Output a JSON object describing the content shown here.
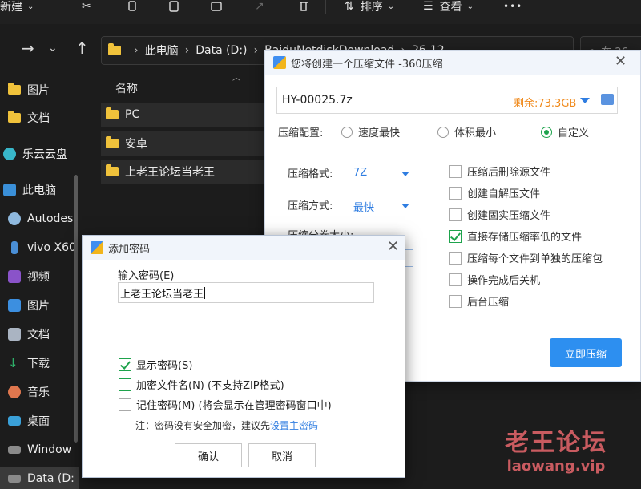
{
  "toolbar": {
    "new_label": "新建",
    "sort_label": "排序",
    "view_label": "查看",
    "more_label": "•••"
  },
  "address": {
    "parts": [
      "此电脑",
      "Data (D:)",
      "BaiduNetdiskDownload",
      "26-12"
    ],
    "search_placeholder": "在 26"
  },
  "sidebar": {
    "items": [
      {
        "label": "图片"
      },
      {
        "label": "文档"
      },
      {
        "label": "乐云云盘"
      },
      {
        "label": "此电脑"
      },
      {
        "label": "Autodes"
      },
      {
        "label": "vivo X60"
      },
      {
        "label": "视频"
      },
      {
        "label": "图片"
      },
      {
        "label": "文档"
      },
      {
        "label": "下载"
      },
      {
        "label": "音乐"
      },
      {
        "label": "桌面"
      },
      {
        "label": "Window"
      },
      {
        "label": "Data (D:"
      }
    ]
  },
  "filelist": {
    "column_name": "名称",
    "rows": [
      {
        "name": "PC"
      },
      {
        "name": "安卓"
      },
      {
        "name": "上老王论坛当老王"
      }
    ]
  },
  "compress_dialog": {
    "title": "您将创建一个压缩文件 -360压缩",
    "filename": "HY-00025.7z",
    "remaining": "剩余:73.3GB",
    "config_label": "压缩配置:",
    "radios": [
      {
        "label": "速度最快",
        "checked": false
      },
      {
        "label": "体积最小",
        "checked": false
      },
      {
        "label": "自定义",
        "checked": true
      }
    ],
    "format_label": "压缩格式:",
    "format_value": "7Z",
    "method_label": "压缩方式:",
    "method_value": "最快",
    "split_label": "压缩分卷大小:",
    "options": [
      {
        "label": "压缩后删除源文件",
        "checked": false
      },
      {
        "label": "创建自解压文件",
        "checked": false
      },
      {
        "label": "创建固实压缩文件",
        "checked": false
      },
      {
        "label": "直接存储压缩率低的文件",
        "checked": true
      },
      {
        "label": "压缩每个文件到单独的压缩包",
        "checked": false
      },
      {
        "label": "操作完成后关机",
        "checked": false
      },
      {
        "label": "后台压缩",
        "checked": false
      }
    ],
    "submit_label": "立即压缩"
  },
  "password_dialog": {
    "title": "添加密码",
    "input_label": "输入密码(E)",
    "password_value": "上老王论坛当老王",
    "checkboxes": [
      {
        "label": "显示密码(S)",
        "checked": true
      },
      {
        "label": "加密文件名(N) (不支持ZIP格式)",
        "checked": false
      },
      {
        "label": "记住密码(M) (将会显示在管理密码窗口中)",
        "checked": false
      }
    ],
    "note_text": "注：密码没有安全加密，建议先",
    "note_link": "设置主密码",
    "ok_label": "确认",
    "cancel_label": "取消"
  },
  "watermark": {
    "title": "老王论坛",
    "domain": "laowang.vip"
  },
  "colors": {
    "explorer_bg": "#1c1c1c",
    "accent_blue": "#2d8ff0",
    "check_green": "#1ea34c",
    "remain_orange": "#f08a1c"
  }
}
